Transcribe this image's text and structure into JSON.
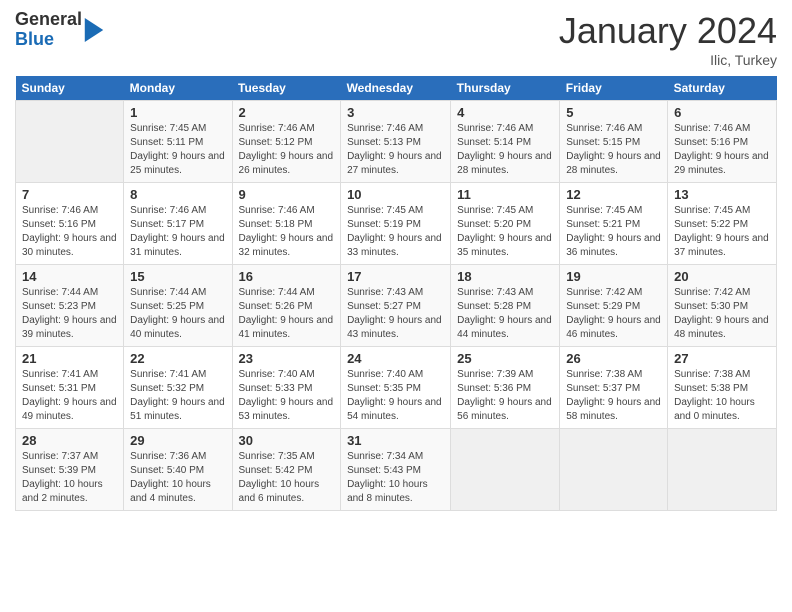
{
  "logo": {
    "general": "General",
    "blue": "Blue"
  },
  "title": "January 2024",
  "location": "Ilic, Turkey",
  "days_header": [
    "Sunday",
    "Monday",
    "Tuesday",
    "Wednesday",
    "Thursday",
    "Friday",
    "Saturday"
  ],
  "weeks": [
    [
      {
        "num": "",
        "sunrise": "",
        "sunset": "",
        "daylight": ""
      },
      {
        "num": "1",
        "sunrise": "Sunrise: 7:45 AM",
        "sunset": "Sunset: 5:11 PM",
        "daylight": "Daylight: 9 hours and 25 minutes."
      },
      {
        "num": "2",
        "sunrise": "Sunrise: 7:46 AM",
        "sunset": "Sunset: 5:12 PM",
        "daylight": "Daylight: 9 hours and 26 minutes."
      },
      {
        "num": "3",
        "sunrise": "Sunrise: 7:46 AM",
        "sunset": "Sunset: 5:13 PM",
        "daylight": "Daylight: 9 hours and 27 minutes."
      },
      {
        "num": "4",
        "sunrise": "Sunrise: 7:46 AM",
        "sunset": "Sunset: 5:14 PM",
        "daylight": "Daylight: 9 hours and 28 minutes."
      },
      {
        "num": "5",
        "sunrise": "Sunrise: 7:46 AM",
        "sunset": "Sunset: 5:15 PM",
        "daylight": "Daylight: 9 hours and 28 minutes."
      },
      {
        "num": "6",
        "sunrise": "Sunrise: 7:46 AM",
        "sunset": "Sunset: 5:16 PM",
        "daylight": "Daylight: 9 hours and 29 minutes."
      }
    ],
    [
      {
        "num": "7",
        "sunrise": "Sunrise: 7:46 AM",
        "sunset": "Sunset: 5:16 PM",
        "daylight": "Daylight: 9 hours and 30 minutes."
      },
      {
        "num": "8",
        "sunrise": "Sunrise: 7:46 AM",
        "sunset": "Sunset: 5:17 PM",
        "daylight": "Daylight: 9 hours and 31 minutes."
      },
      {
        "num": "9",
        "sunrise": "Sunrise: 7:46 AM",
        "sunset": "Sunset: 5:18 PM",
        "daylight": "Daylight: 9 hours and 32 minutes."
      },
      {
        "num": "10",
        "sunrise": "Sunrise: 7:45 AM",
        "sunset": "Sunset: 5:19 PM",
        "daylight": "Daylight: 9 hours and 33 minutes."
      },
      {
        "num": "11",
        "sunrise": "Sunrise: 7:45 AM",
        "sunset": "Sunset: 5:20 PM",
        "daylight": "Daylight: 9 hours and 35 minutes."
      },
      {
        "num": "12",
        "sunrise": "Sunrise: 7:45 AM",
        "sunset": "Sunset: 5:21 PM",
        "daylight": "Daylight: 9 hours and 36 minutes."
      },
      {
        "num": "13",
        "sunrise": "Sunrise: 7:45 AM",
        "sunset": "Sunset: 5:22 PM",
        "daylight": "Daylight: 9 hours and 37 minutes."
      }
    ],
    [
      {
        "num": "14",
        "sunrise": "Sunrise: 7:44 AM",
        "sunset": "Sunset: 5:23 PM",
        "daylight": "Daylight: 9 hours and 39 minutes."
      },
      {
        "num": "15",
        "sunrise": "Sunrise: 7:44 AM",
        "sunset": "Sunset: 5:25 PM",
        "daylight": "Daylight: 9 hours and 40 minutes."
      },
      {
        "num": "16",
        "sunrise": "Sunrise: 7:44 AM",
        "sunset": "Sunset: 5:26 PM",
        "daylight": "Daylight: 9 hours and 41 minutes."
      },
      {
        "num": "17",
        "sunrise": "Sunrise: 7:43 AM",
        "sunset": "Sunset: 5:27 PM",
        "daylight": "Daylight: 9 hours and 43 minutes."
      },
      {
        "num": "18",
        "sunrise": "Sunrise: 7:43 AM",
        "sunset": "Sunset: 5:28 PM",
        "daylight": "Daylight: 9 hours and 44 minutes."
      },
      {
        "num": "19",
        "sunrise": "Sunrise: 7:42 AM",
        "sunset": "Sunset: 5:29 PM",
        "daylight": "Daylight: 9 hours and 46 minutes."
      },
      {
        "num": "20",
        "sunrise": "Sunrise: 7:42 AM",
        "sunset": "Sunset: 5:30 PM",
        "daylight": "Daylight: 9 hours and 48 minutes."
      }
    ],
    [
      {
        "num": "21",
        "sunrise": "Sunrise: 7:41 AM",
        "sunset": "Sunset: 5:31 PM",
        "daylight": "Daylight: 9 hours and 49 minutes."
      },
      {
        "num": "22",
        "sunrise": "Sunrise: 7:41 AM",
        "sunset": "Sunset: 5:32 PM",
        "daylight": "Daylight: 9 hours and 51 minutes."
      },
      {
        "num": "23",
        "sunrise": "Sunrise: 7:40 AM",
        "sunset": "Sunset: 5:33 PM",
        "daylight": "Daylight: 9 hours and 53 minutes."
      },
      {
        "num": "24",
        "sunrise": "Sunrise: 7:40 AM",
        "sunset": "Sunset: 5:35 PM",
        "daylight": "Daylight: 9 hours and 54 minutes."
      },
      {
        "num": "25",
        "sunrise": "Sunrise: 7:39 AM",
        "sunset": "Sunset: 5:36 PM",
        "daylight": "Daylight: 9 hours and 56 minutes."
      },
      {
        "num": "26",
        "sunrise": "Sunrise: 7:38 AM",
        "sunset": "Sunset: 5:37 PM",
        "daylight": "Daylight: 9 hours and 58 minutes."
      },
      {
        "num": "27",
        "sunrise": "Sunrise: 7:38 AM",
        "sunset": "Sunset: 5:38 PM",
        "daylight": "Daylight: 10 hours and 0 minutes."
      }
    ],
    [
      {
        "num": "28",
        "sunrise": "Sunrise: 7:37 AM",
        "sunset": "Sunset: 5:39 PM",
        "daylight": "Daylight: 10 hours and 2 minutes."
      },
      {
        "num": "29",
        "sunrise": "Sunrise: 7:36 AM",
        "sunset": "Sunset: 5:40 PM",
        "daylight": "Daylight: 10 hours and 4 minutes."
      },
      {
        "num": "30",
        "sunrise": "Sunrise: 7:35 AM",
        "sunset": "Sunset: 5:42 PM",
        "daylight": "Daylight: 10 hours and 6 minutes."
      },
      {
        "num": "31",
        "sunrise": "Sunrise: 7:34 AM",
        "sunset": "Sunset: 5:43 PM",
        "daylight": "Daylight: 10 hours and 8 minutes."
      },
      {
        "num": "",
        "sunrise": "",
        "sunset": "",
        "daylight": ""
      },
      {
        "num": "",
        "sunrise": "",
        "sunset": "",
        "daylight": ""
      },
      {
        "num": "",
        "sunrise": "",
        "sunset": "",
        "daylight": ""
      }
    ]
  ]
}
